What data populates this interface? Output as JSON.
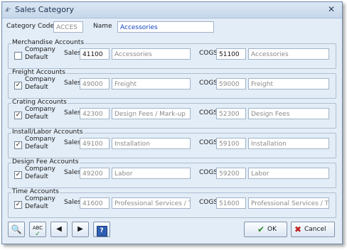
{
  "window": {
    "title": "Sales Category"
  },
  "header": {
    "code_label": "Category Code",
    "code_value": "ACCES",
    "name_label": "Name",
    "name_value": "Accessories"
  },
  "labels": {
    "company_default": "Company Default",
    "sales": "Sales",
    "cogs": "COGS"
  },
  "groups": [
    {
      "title": "Merchandise Accounts",
      "checked": false,
      "sales_code": "41100",
      "sales_desc": "Accessories",
      "cogs_code": "51100",
      "cogs_desc": "Accessories"
    },
    {
      "title": "Freight Accounts",
      "checked": true,
      "sales_code": "49000",
      "sales_desc": "Freight",
      "cogs_code": "59000",
      "cogs_desc": "Freight"
    },
    {
      "title": "Crating Accounts",
      "checked": true,
      "sales_code": "42300",
      "sales_desc": "Design Fees / Mark-up",
      "cogs_code": "52300",
      "cogs_desc": "Design Fees"
    },
    {
      "title": "Install/Labor Accounts",
      "checked": true,
      "sales_code": "49100",
      "sales_desc": "Installation",
      "cogs_code": "59100",
      "cogs_desc": "Installation"
    },
    {
      "title": "Design Fee Accounts",
      "checked": true,
      "sales_code": "49200",
      "sales_desc": "Labor",
      "cogs_code": "59200",
      "cogs_desc": "Labor"
    },
    {
      "title": "Time Accounts",
      "checked": true,
      "sales_code": "41600",
      "sales_desc": "Professional Services / Tim",
      "cogs_code": "51600",
      "cogs_desc": "Professional Services / Tim"
    }
  ],
  "buttons": {
    "ok": "OK",
    "cancel": "Cancel",
    "spell_text": "ABC"
  },
  "icons": {
    "check_mark": "✓",
    "ok_icon": "✔",
    "cancel_icon": "✖",
    "close_icon": "✕",
    "find_icon": "🔍",
    "prev_icon": "◀",
    "next_icon": "▶",
    "help_icon": "?"
  }
}
